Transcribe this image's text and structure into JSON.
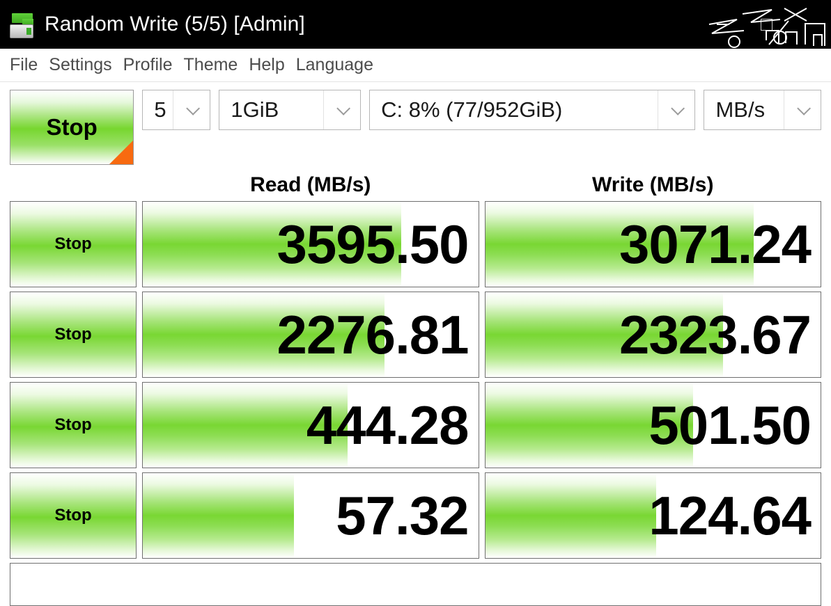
{
  "window": {
    "title": "Random Write (5/5) [Admin]",
    "icon": "disk-drive-icon",
    "controls": {
      "minimize": "─",
      "maximize": "□",
      "close": "✕"
    }
  },
  "menu": {
    "items": [
      {
        "label": "File"
      },
      {
        "label": "Settings"
      },
      {
        "label": "Profile"
      },
      {
        "label": "Theme"
      },
      {
        "label": "Help"
      },
      {
        "label": "Language"
      }
    ]
  },
  "toolbar": {
    "main_button_label": "Stop",
    "count": {
      "value": "5"
    },
    "size": {
      "value": "1GiB"
    },
    "drive": {
      "value": "C: 8% (77/952GiB)"
    },
    "unit": {
      "value": "MB/s"
    }
  },
  "columns": {
    "read_header": "Read (MB/s)",
    "write_header": "Write (MB/s)"
  },
  "rows": [
    {
      "button_label": "Stop",
      "read": "3595.50",
      "write": "3071.24",
      "read_fill": 77,
      "write_fill": 80
    },
    {
      "button_label": "Stop",
      "read": "2276.81",
      "write": "2323.67",
      "read_fill": 72,
      "write_fill": 71
    },
    {
      "button_label": "Stop",
      "read": "444.28",
      "write": "501.50",
      "read_fill": 61,
      "write_fill": 62
    },
    {
      "button_label": "Stop",
      "read": "57.32",
      "write": "124.64",
      "read_fill": 45,
      "write_fill": 51
    }
  ],
  "statusbar": {
    "text": ""
  },
  "colors": {
    "accent_green": "#79d733",
    "corner_orange": "#f86a10",
    "titlebar_bg": "#000000",
    "menu_text": "#4c4c4c"
  }
}
